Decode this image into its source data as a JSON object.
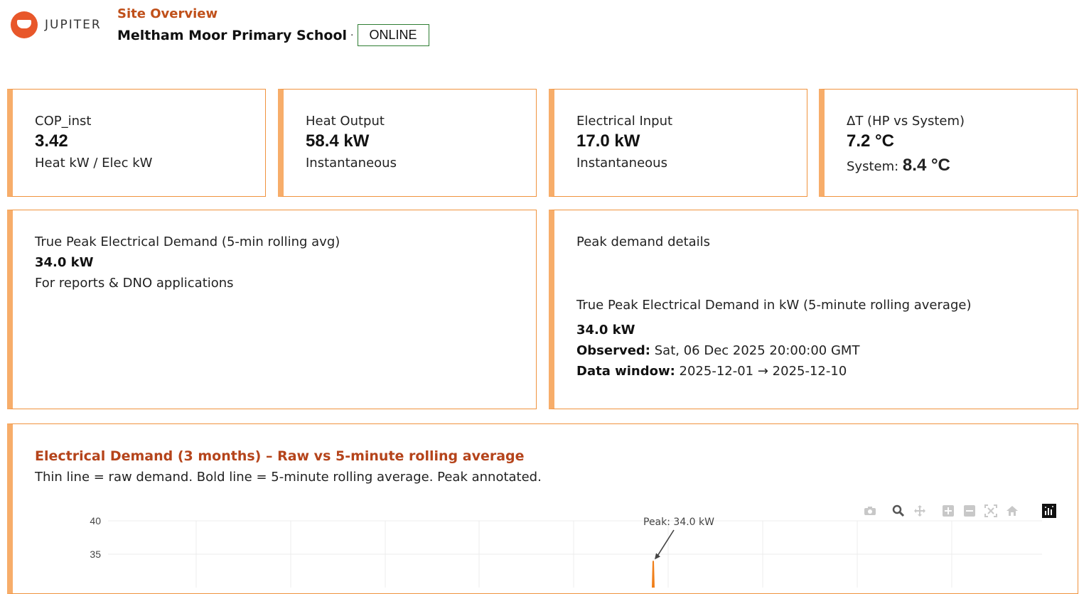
{
  "app": {
    "logo_text": "JUPITER",
    "page_title": "Site Overview"
  },
  "site": {
    "name": "Meltham Moor Primary School",
    "separator": "·",
    "status": "ONLINE"
  },
  "kpis": [
    {
      "label": "COP_inst",
      "value": "3.42",
      "sub": "Heat kW / Elec kW"
    },
    {
      "label": "Heat Output",
      "value": "58.4 kW",
      "sub": "Instantaneous"
    },
    {
      "label": "Electrical Input",
      "value": "17.0 kW",
      "sub": "Instantaneous"
    },
    {
      "label": "ΔT (HP vs System)",
      "value": "7.2 °C",
      "sub_label": "System:",
      "sub_value": "8.4 °C"
    }
  ],
  "peak_card": {
    "title": "True Peak Electrical Demand (5-min rolling avg)",
    "value": "34.0 kW",
    "note": "For reports & DNO applications"
  },
  "details_card": {
    "title": "Peak demand details",
    "heading": "True Peak Electrical Demand in kW (5-minute rolling average)",
    "value": "34.0 kW",
    "observed_label": "Observed:",
    "observed_value": "Sat, 06 Dec 2025 20:00:00 GMT",
    "window_label": "Data window:",
    "window_value": "2025-12-01 → 2025-12-10"
  },
  "chart_card": {
    "title": "Electrical Demand (3 months) – Raw vs 5-minute rolling average",
    "subtitle": "Thin line = raw demand. Bold line = 5-minute rolling average. Peak annotated."
  },
  "modebar": [
    "camera-icon",
    "zoom-icon",
    "pan-icon",
    "zoom-in-icon",
    "zoom-out-icon",
    "autoscale-icon",
    "home-icon",
    "plotly-logo-icon"
  ],
  "chart_data": {
    "type": "line",
    "yticks": [
      35,
      40
    ],
    "ylim_visible": [
      33,
      40
    ],
    "annotation": "Peak: 34.0 kW",
    "peak_value": 34.0,
    "series_color": "#f07f1a"
  },
  "colors": {
    "accent": "#f0933e",
    "accent_left": "#f7ad6a",
    "title": "#b5441b",
    "status_border": "#2e7d32"
  }
}
